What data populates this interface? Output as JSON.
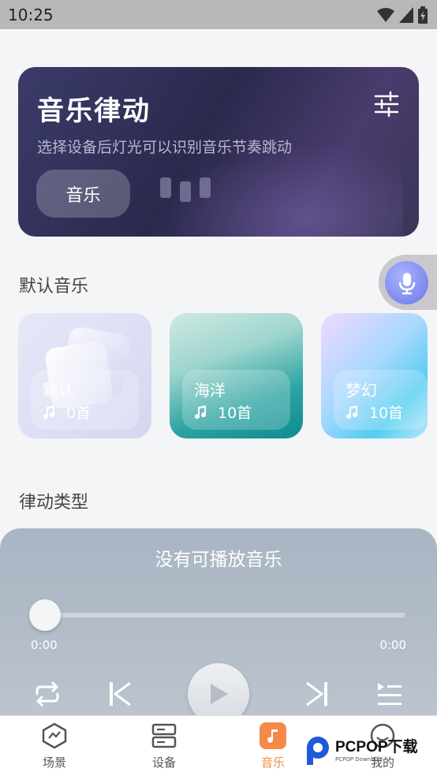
{
  "status_bar": {
    "time": "10:25"
  },
  "hero": {
    "title": "音乐律动",
    "subtitle": "选择设备后灯光可以识别音乐节奏跳动",
    "button_label": "音乐"
  },
  "default_music": {
    "section_title": "默认音乐",
    "cards": [
      {
        "name": "默认",
        "count": "0首"
      },
      {
        "name": "海洋",
        "count": "10首"
      },
      {
        "name": "梦幻",
        "count": "10首"
      }
    ]
  },
  "rhythm_type": {
    "section_title": "律动类型"
  },
  "player": {
    "title": "没有可播放音乐",
    "current_time": "0:00",
    "total_time": "0:00",
    "progress": 0
  },
  "nav": {
    "items": [
      {
        "label": "场景",
        "icon": "scene-icon",
        "active": false
      },
      {
        "label": "设备",
        "icon": "device-icon",
        "active": false
      },
      {
        "label": "音乐",
        "icon": "music-note-icon",
        "active": true
      },
      {
        "label": "我的",
        "icon": "smiley-icon",
        "active": false
      }
    ]
  },
  "watermark": {
    "brand": "PCPOP下载",
    "sub": "PCPOP Download"
  },
  "colors": {
    "accent": "#f28a3b",
    "mic": "#7a85ee"
  }
}
